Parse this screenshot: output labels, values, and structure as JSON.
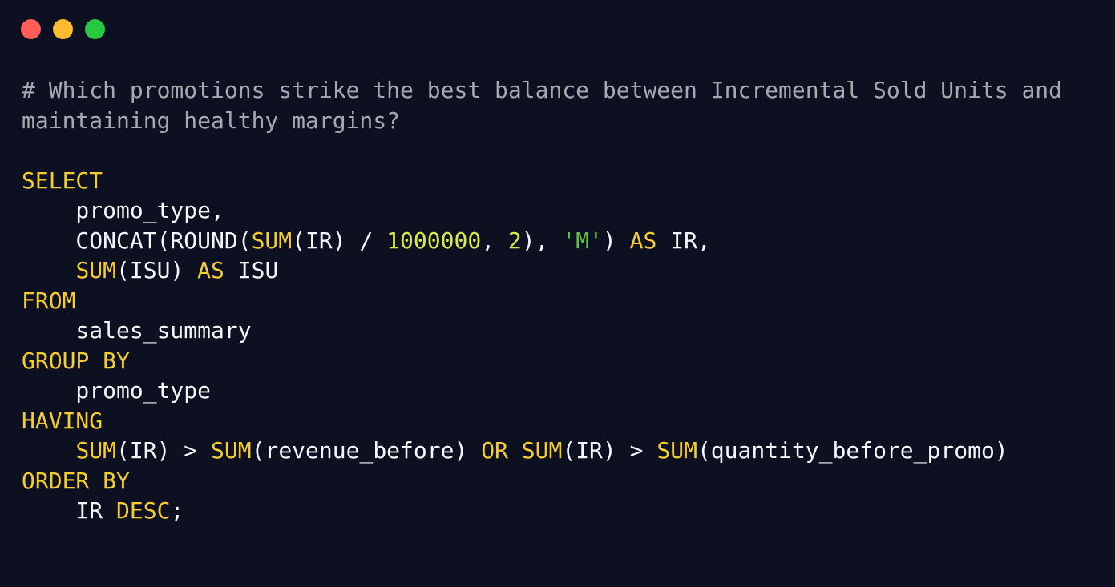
{
  "window": {
    "controls": [
      {
        "name": "close",
        "color": "#ff5f57"
      },
      {
        "name": "minimize",
        "color": "#febc2e"
      },
      {
        "name": "zoom",
        "color": "#28c840"
      }
    ]
  },
  "colors": {
    "background": "#0d1021",
    "comment": "#a7a9b0",
    "keyword": "#f4cd30",
    "number": "#d8ea4b",
    "string": "#58c43d",
    "identifier": "#f5f7fb"
  },
  "code": {
    "lines": [
      [
        {
          "t": "comment",
          "v": "# Which promotions strike the best balance between Incremental Sold Units and"
        }
      ],
      [
        {
          "t": "comment",
          "v": "maintaining healthy margins?"
        }
      ],
      [],
      [
        {
          "t": "keyword",
          "v": "SELECT"
        }
      ],
      [
        {
          "t": "ident",
          "v": "    promo_type,"
        }
      ],
      [
        {
          "t": "ident",
          "v": "    CONCAT(ROUND("
        },
        {
          "t": "keyword",
          "v": "SUM"
        },
        {
          "t": "ident",
          "v": "(IR) / "
        },
        {
          "t": "number",
          "v": "1000000"
        },
        {
          "t": "ident",
          "v": ", "
        },
        {
          "t": "number",
          "v": "2"
        },
        {
          "t": "ident",
          "v": "), "
        },
        {
          "t": "string",
          "v": "'M'"
        },
        {
          "t": "ident",
          "v": ") "
        },
        {
          "t": "keyword",
          "v": "AS"
        },
        {
          "t": "ident",
          "v": " IR,"
        }
      ],
      [
        {
          "t": "ident",
          "v": "    "
        },
        {
          "t": "keyword",
          "v": "SUM"
        },
        {
          "t": "ident",
          "v": "(ISU) "
        },
        {
          "t": "keyword",
          "v": "AS"
        },
        {
          "t": "ident",
          "v": " ISU"
        }
      ],
      [
        {
          "t": "keyword",
          "v": "FROM"
        }
      ],
      [
        {
          "t": "ident",
          "v": "    sales_summary"
        }
      ],
      [
        {
          "t": "keyword",
          "v": "GROUP BY"
        }
      ],
      [
        {
          "t": "ident",
          "v": "    promo_type"
        }
      ],
      [
        {
          "t": "keyword",
          "v": "HAVING"
        }
      ],
      [
        {
          "t": "ident",
          "v": "    "
        },
        {
          "t": "keyword",
          "v": "SUM"
        },
        {
          "t": "ident",
          "v": "(IR) > "
        },
        {
          "t": "keyword",
          "v": "SUM"
        },
        {
          "t": "ident",
          "v": "(revenue_before) "
        },
        {
          "t": "keyword",
          "v": "OR"
        },
        {
          "t": "ident",
          "v": " "
        },
        {
          "t": "keyword",
          "v": "SUM"
        },
        {
          "t": "ident",
          "v": "(IR) > "
        },
        {
          "t": "keyword",
          "v": "SUM"
        },
        {
          "t": "ident",
          "v": "(quantity_before_promo)"
        }
      ],
      [
        {
          "t": "keyword",
          "v": "ORDER BY"
        }
      ],
      [
        {
          "t": "ident",
          "v": "    IR "
        },
        {
          "t": "keyword",
          "v": "DESC"
        },
        {
          "t": "ident",
          "v": ";"
        }
      ]
    ]
  }
}
